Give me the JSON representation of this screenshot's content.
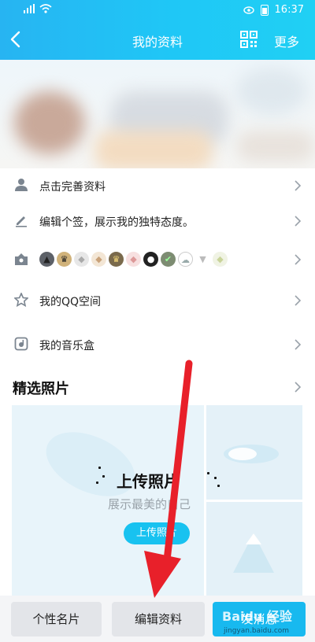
{
  "statusbar": {
    "time": "16:37"
  },
  "navbar": {
    "title": "我的资料",
    "more": "更多"
  },
  "rows": [
    {
      "label": "点击完善资料",
      "icon": "person-icon"
    },
    {
      "label": "编辑个签，展示我的独特态度。",
      "icon": "pencil-icon"
    },
    {
      "label": "",
      "icon": "badge-box-icon"
    },
    {
      "label": "我的QQ空间",
      "icon": "star-icon"
    },
    {
      "label": "我的音乐盒",
      "icon": "music-box-icon"
    }
  ],
  "section": {
    "title": "精选照片"
  },
  "upload": {
    "title": "上传照片",
    "subtitle": "展示最美的自己",
    "button": "上传照片"
  },
  "bottom": {
    "card": "个性名片",
    "edit": "编辑资料",
    "send": "发消息"
  },
  "watermark": {
    "brand": "Baidu 经验",
    "url": "jingyan.baidu.com"
  },
  "colors": {
    "header_start": "#27b4f2",
    "header_end": "#20d0f4",
    "accent": "#18c2f0",
    "arrow": "#e8202a"
  }
}
